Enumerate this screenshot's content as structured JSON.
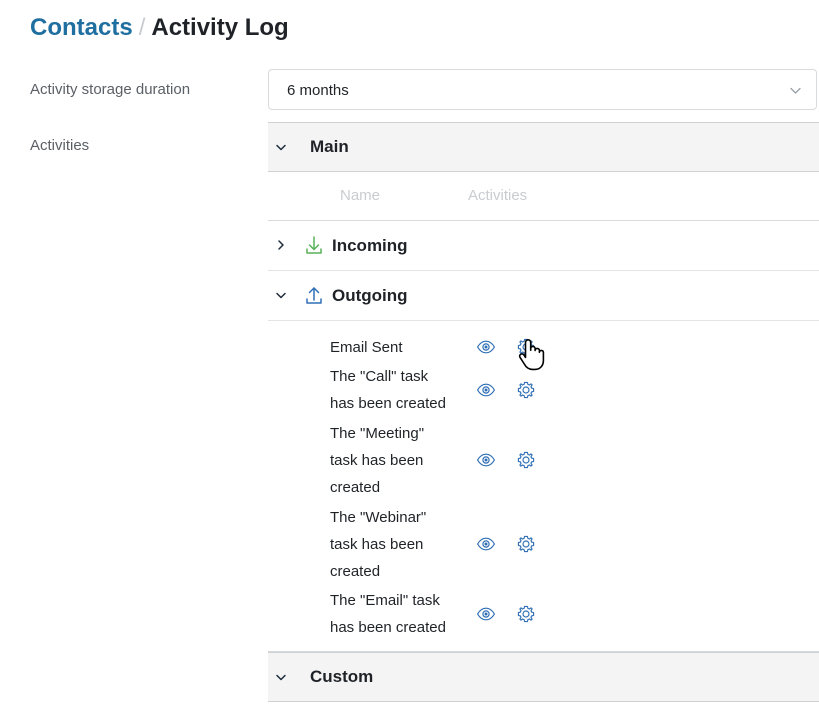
{
  "breadcrumb": {
    "parent": "Contacts",
    "separator": "/",
    "current": "Activity Log"
  },
  "form": {
    "duration_label": "Activity storage duration",
    "activities_label": "Activities",
    "duration_select": {
      "value": "6 months",
      "caret_icon": "chevron-down-icon"
    }
  },
  "tree": {
    "columns": {
      "name": "Name",
      "activities": "Activities"
    },
    "groups": [
      {
        "title": "Main",
        "twisty_icon": "chevron-down-icon",
        "expanded": true
      },
      {
        "title": "Custom",
        "twisty_icon": "chevron-down-icon",
        "expanded": true
      }
    ],
    "branches": [
      {
        "label": "Incoming",
        "twisty_icon": "chevron-right-icon",
        "dir_icon": "arrow-down-tray-icon",
        "dir_color": "#59b159",
        "expanded": false
      },
      {
        "label": "Outgoing",
        "twisty_icon": "chevron-down-icon",
        "dir_icon": "arrow-up-tray-icon",
        "dir_color": "#2f6fb5",
        "expanded": true
      }
    ],
    "outgoing_items": [
      {
        "name": "Email Sent",
        "eye_icon": "eye-icon",
        "gear_icon": "gear-icon"
      },
      {
        "name": "The \"Call\" task has been created",
        "eye_icon": "eye-icon",
        "gear_icon": "gear-icon"
      },
      {
        "name": "The \"Meeting\" task has been created",
        "eye_icon": "eye-icon",
        "gear_icon": "gear-icon"
      },
      {
        "name": "The \"Webinar\" task has been created",
        "eye_icon": "eye-icon",
        "gear_icon": "gear-icon"
      },
      {
        "name": "The \"Email\" task has been created",
        "eye_icon": "eye-icon",
        "gear_icon": "gear-icon"
      }
    ]
  },
  "cursor": {
    "icon": "pointer-hand-cursor"
  },
  "colors": {
    "link": "#1f6fa0",
    "text": "#1f2328",
    "muted_label": "#5a6066",
    "column_header": "#c9ccd0",
    "band_background": "#f4f4f4",
    "action_icon": "#2f6fb5",
    "incoming": "#59b159",
    "outgoing": "#2f6fb5"
  }
}
